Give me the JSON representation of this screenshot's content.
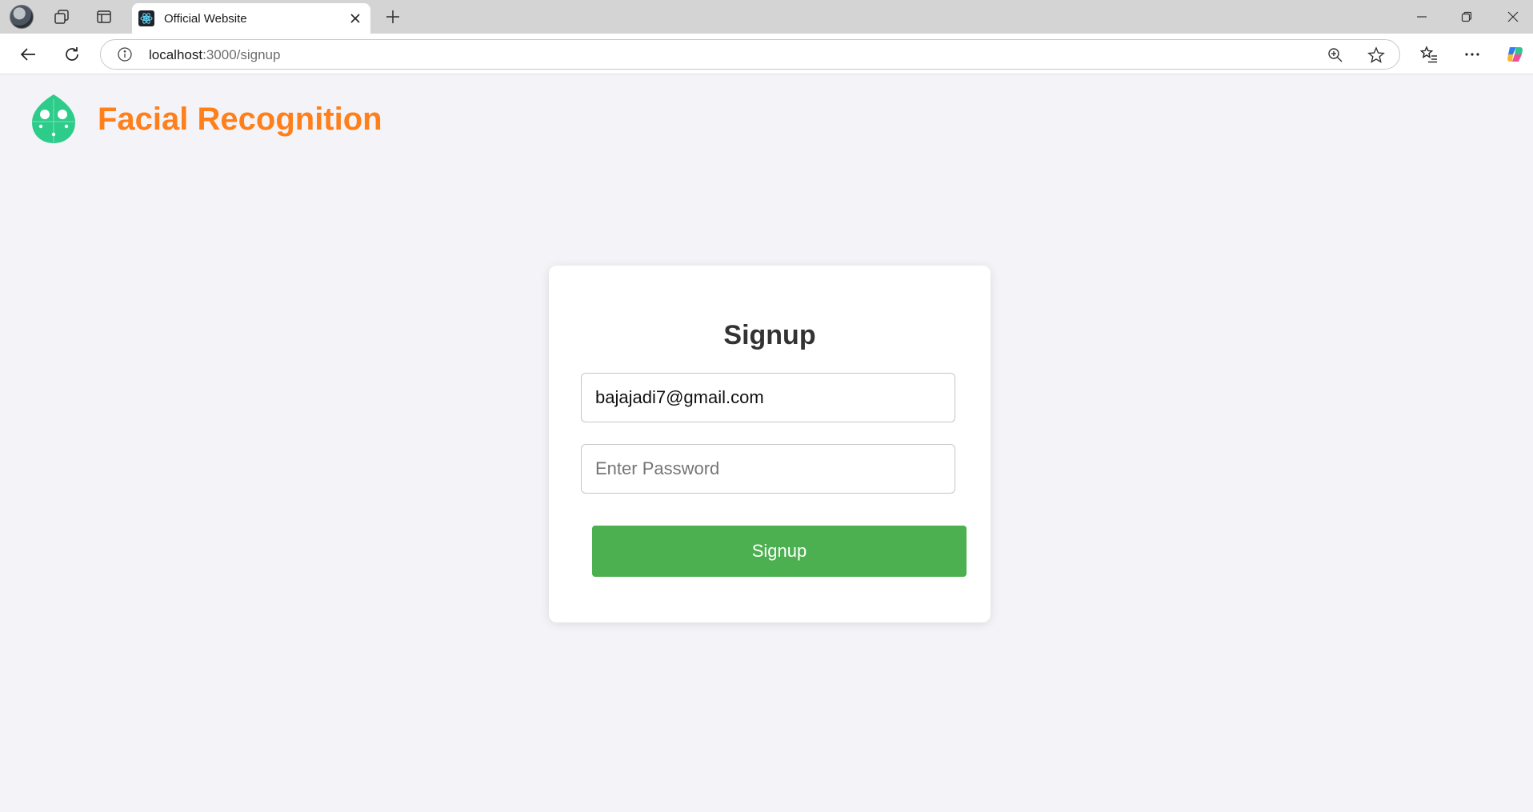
{
  "browser": {
    "tab_title": "Official Website",
    "url_host": "localhost",
    "url_path": ":3000/signup"
  },
  "header": {
    "brand_title": "Facial Recognition"
  },
  "signup_form": {
    "heading": "Signup",
    "email_value": "bajajadi7@gmail.com",
    "password_placeholder": "Enter Password",
    "submit_label": "Signup"
  },
  "colors": {
    "brand_orange": "#ff7f1a",
    "logo_green": "#2ecc8a",
    "button_green": "#4caf50",
    "page_background": "#f4f4f8"
  }
}
